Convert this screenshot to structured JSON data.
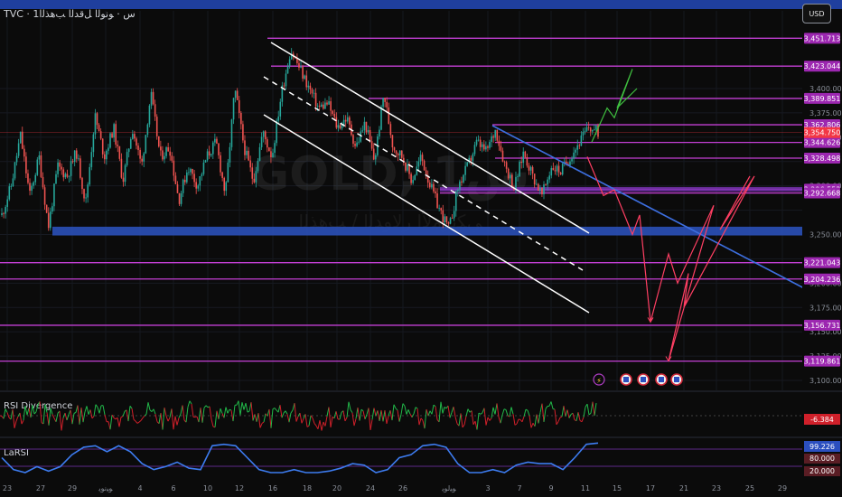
{
  "header": {
    "symbol_text": "TVC · 1ﺱ · ﻮﻧﻮﻟﺍ ﻞﻗﺪﻟﺍ ﺐﻫﺬﻟﺍ",
    "currency_button": "USD",
    "watermark_symbol": "GOLD, 1ﺱ",
    "watermark_subtitle": "ﻲﻜﻳﺮﻣﻷﺍ ﺭﻻﻭﺪﻟﺍ / ﺐﻫﺬﻟﺍ"
  },
  "colors": {
    "background": "#0b0b0b",
    "level_line": "#c33fd4",
    "level_label_bg": "#9c27b0",
    "support_zone": "#2a50b8",
    "up_candle": "#26a69a",
    "down_candle": "#ef5350",
    "trendline": "#3d6fe0",
    "channel": "#ffffff",
    "projection_up": "#3fbf3f",
    "projection_down": "#ff3f63",
    "rsi_up": "#22b94a",
    "rsi_down": "#d0202a",
    "larsi_line": "#3d7cf0",
    "current_price_bg": "#f23645"
  },
  "chart_data": {
    "type": "line",
    "title": "GOLD, 1ﺱ",
    "interval": "1 hour",
    "y_axis": {
      "ylim": [
        3090,
        3465
      ],
      "ticks": [
        3100,
        3125,
        3150,
        3175,
        3200,
        3225,
        3250,
        3275,
        3300,
        3325,
        3350,
        3375,
        3400
      ]
    },
    "x_axis": {
      "tick_labels": [
        "23",
        "27",
        "29",
        "ﻮﻴﻧﻮﻳ",
        "4",
        "6",
        "10",
        "12",
        "16",
        "18",
        "20",
        "24",
        "26",
        "ﻮﻴﻟﻮﻳ",
        "3",
        "7",
        "9",
        "11",
        "15",
        "17",
        "21",
        "23",
        "25",
        "29"
      ]
    },
    "price_path": [
      3270,
      3300,
      3352,
      3290,
      3330,
      3258,
      3320,
      3310,
      3335,
      3282,
      3372,
      3330,
      3360,
      3305,
      3360,
      3320,
      3395,
      3330,
      3340,
      3285,
      3320,
      3300,
      3330,
      3345,
      3290,
      3400,
      3340,
      3305,
      3355,
      3330,
      3395,
      3440,
      3420,
      3400,
      3380,
      3385,
      3360,
      3370,
      3340,
      3365,
      3325,
      3395,
      3340,
      3330,
      3305,
      3330,
      3300,
      3275,
      3255,
      3300,
      3320,
      3345,
      3335,
      3358,
      3322,
      3298,
      3335,
      3310,
      3290,
      3320,
      3315,
      3330,
      3345,
      3360,
      3355
    ],
    "current_price": "3,354.750",
    "horizontal_levels": [
      "3,451.713",
      "3,423.044",
      "3,389.851",
      "3,362.806",
      "3,344.626",
      "3,328.498",
      "3,296.553",
      "3,292.668",
      "3,221.043",
      "3,204.236",
      "3,156.731",
      "3,119.861"
    ],
    "support_zone": [
      3249,
      3258
    ],
    "annotations": {
      "projection_up_path": [
        3345,
        3380,
        3370,
        3420,
        3380,
        3400
      ],
      "projection_down_path": [
        3330,
        3290,
        3296,
        3250,
        3270,
        3160,
        3230,
        3200,
        3280,
        3120,
        3210,
        3175,
        3310,
        3255,
        3310
      ]
    }
  },
  "indicators": {
    "rsi": {
      "label": "RSI Divergence",
      "current_value": "-6.384",
      "series_seed": 7
    },
    "larsi": {
      "label": "LaRSI",
      "current_value": "99.226",
      "levels": [
        "80.000",
        "20.000"
      ],
      "values": [
        0.5,
        0.1,
        0,
        0.2,
        0.05,
        0.2,
        0.6,
        0.85,
        0.9,
        0.7,
        0.9,
        0.7,
        0.3,
        0.1,
        0.2,
        0.35,
        0.15,
        0.1,
        0.9,
        0.95,
        0.9,
        0.5,
        0.1,
        0,
        0,
        0.1,
        0,
        0,
        0.05,
        0.15,
        0.3,
        0.25,
        0,
        0.1,
        0.5,
        0.6,
        0.9,
        0.95,
        0.85,
        0.3,
        0,
        0,
        0.1,
        0,
        0.25,
        0.35,
        0.3,
        0.3,
        0.1,
        0.5,
        0.95,
        0.99
      ]
    }
  }
}
